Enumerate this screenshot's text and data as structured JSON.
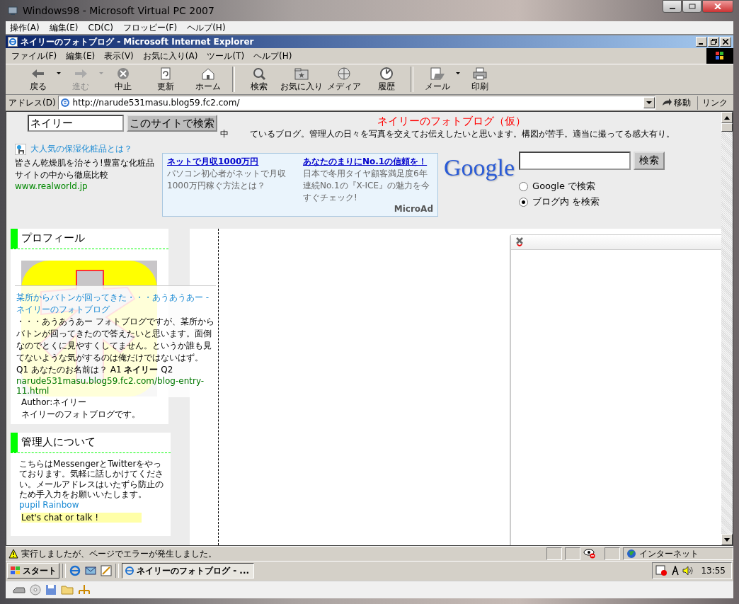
{
  "host_window": {
    "title": "Windows98 - Microsoft Virtual PC 2007",
    "menu": [
      "操作(A)",
      "編集(E)",
      "CD(C)",
      "フロッピー(F)",
      "ヘルプ(H)"
    ]
  },
  "browser": {
    "title": "ネイリーのフォトブログ - Microsoft Internet Explorer",
    "menu": [
      "ファイル(F)",
      "編集(E)",
      "表示(V)",
      "お気に入り(A)",
      "ツール(T)",
      "ヘルプ(H)"
    ],
    "toolbar": [
      {
        "kind": "back",
        "label": "戻る",
        "disabled": false,
        "dropdown": true
      },
      {
        "kind": "forward",
        "label": "進む",
        "disabled": true,
        "dropdown": true
      },
      {
        "kind": "stop",
        "label": "中止",
        "disabled": false,
        "dropdown": false
      },
      {
        "kind": "refresh",
        "label": "更新",
        "disabled": false,
        "dropdown": false
      },
      {
        "kind": "home",
        "label": "ホーム",
        "disabled": false,
        "dropdown": false
      },
      {
        "kind": "search",
        "label": "検索",
        "disabled": false,
        "dropdown": false
      },
      {
        "kind": "favorites",
        "label": "お気に入り",
        "disabled": false,
        "dropdown": false
      },
      {
        "kind": "media",
        "label": "メディア",
        "disabled": false,
        "dropdown": false
      },
      {
        "kind": "history",
        "label": "履歴",
        "disabled": false,
        "dropdown": false
      },
      {
        "kind": "mail",
        "label": "メール",
        "disabled": false,
        "dropdown": true
      },
      {
        "kind": "print",
        "label": "印刷",
        "disabled": false,
        "dropdown": false
      }
    ],
    "address": {
      "label": "アドレス(D)",
      "url": "http://narude531masu.blog59.fc2.com/",
      "go": "移動",
      "links": "リンク"
    }
  },
  "page": {
    "site_search": {
      "value": "ネイリー",
      "button": "このサイトで検索"
    },
    "blog_title": "ネイリーのフォトブログ（仮）",
    "description_start": "中",
    "description": "ているブログ。管理人の日々を写真を交えてお伝えしたいと思います。構図が苦手。適当に撮ってる感大有り。",
    "text_ad": {
      "link": "大人気の保湿化粧品とは？",
      "body": "皆さん乾燥肌を治そう!豊富な化粧品サイトの中から徹底比較",
      "url": "www.realworld.jp"
    },
    "micro_ad": {
      "ads": [
        {
          "title": "ネットで月収1000万円",
          "body": "パソコン初心者がネットで月収1000万円稼ぐ方法とは？"
        },
        {
          "title": "あなたのまりにNo.1の信頼を！",
          "body": "日本で冬用タイヤ顧客満足度6年連続No.1の『X-ICE』の魅力を今すぐチェック!"
        }
      ],
      "brand": "MicroAd"
    },
    "google": {
      "logo": "Google",
      "button": "検索",
      "options": [
        {
          "label": "Google で検索",
          "selected": false
        },
        {
          "label": "ブログ内 を検索",
          "selected": true
        }
      ]
    },
    "profile": {
      "heading": "プロフィール",
      "author": "Author:ネイリー",
      "about": "ネイリーのフォトブログです。"
    },
    "search_result": {
      "title": "某所からバトンが回ってきた・・・あうあうあー - ネイリーのフォトブログ",
      "snippet": "・・・あうあうあー フォトブログですが、某所からバトンが回ってきたので答えたいと思います。面倒なのでとくに見やすくしてません。というか誰も見てないような気がするのは俺だけではないはず。 Q1 あなたのお名前は？ A1 **ネイリー** Q2",
      "url": "narude531masu.blog59.fc2.com/blog-entry-11.html"
    },
    "manager": {
      "heading": "管理人について",
      "text": "こちらはMessengerとTwitterをやっております。気軽に話しかけてください。メールアドレスはいたずら防止のため手入力をお願いいたします。",
      "link": "pupil Rainbow",
      "chat": "Let's chat or talk !"
    }
  },
  "status_bar": {
    "message": "実行しましたが、ページでエラーが発生しました。",
    "zone": "インターネット"
  },
  "taskbar": {
    "start": "スタート",
    "task": "ネイリーのフォトブログ - ...",
    "clock": "13:55"
  }
}
